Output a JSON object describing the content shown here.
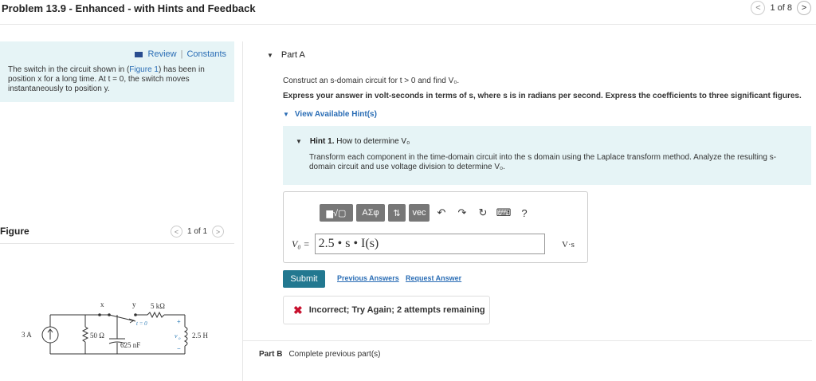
{
  "header": {
    "title": "Problem 13.9 - Enhanced - with Hints and Feedback",
    "pager_text": "1 of 8",
    "prev_glyph": "<",
    "next_glyph": ">"
  },
  "left": {
    "review_label": "Review",
    "sep": "|",
    "constants_label": "Constants",
    "intro_before": "The switch in the circuit shown in (",
    "intro_link": "Figure 1",
    "intro_after": ") has been in position x for a long time. At t = 0, the switch moves instantaneously to position y.",
    "figure_label": "Figure",
    "figure_pager": "1 of 1",
    "fig_prev": "<",
    "fig_next": ">"
  },
  "circuit": {
    "source_label": "3 A",
    "r1_label": "50 Ω",
    "c_label": "625 nF",
    "r2_label": "5 kΩ",
    "l_label": "2.5 H",
    "x_label": "x",
    "y_label": "y",
    "t_label": "t = 0",
    "vo_label": "v",
    "vo_sub": "o",
    "plus": "+",
    "minus": "−"
  },
  "partA": {
    "label": "Part A",
    "question": "Construct an s-domain circuit for t > 0 and find V₀.",
    "instruction": "Express your answer in volt-seconds in terms of s, where s is in radians per second. Express the coefficients to three significant figures.",
    "view_hints": "View Available Hint(s)",
    "hint_number": "Hint 1.",
    "hint_title": "How to determine V₀",
    "hint_body": "Transform each component in the time-domain circuit into the s domain using the Laplace transform method. Analyze the resulting s-domain circuit and use voltage division to determine V₀.",
    "toolbar": {
      "templates": "▆√▢",
      "greek": "ΑΣφ",
      "arrows": "⇅",
      "vec": "vec",
      "undo": "↶",
      "redo": "↷",
      "reset": "↻",
      "keyboard": "⌨",
      "help": "?"
    },
    "answer_label": "V₀ =",
    "answer_value": "2.5 • s • I(s)",
    "unit": "V·s",
    "submit": "Submit",
    "previous_answers": "Previous Answers",
    "request_answer": "Request Answer",
    "feedback": "Incorrect; Try Again; 2 attempts remaining",
    "feedback_icon": "✖"
  },
  "partB": {
    "label": "Part B",
    "status": "Complete previous part(s)"
  }
}
